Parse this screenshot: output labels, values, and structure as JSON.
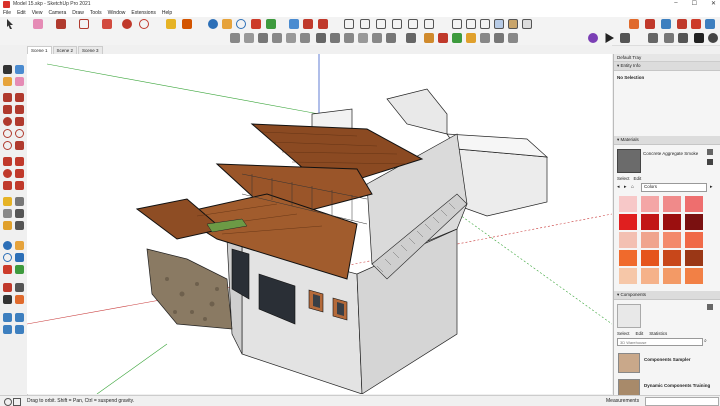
{
  "window": {
    "title": "Model 15.skp - SketchUp Pro 2021"
  },
  "menu": [
    "File",
    "Edit",
    "View",
    "Camera",
    "Draw",
    "Tools",
    "Window",
    "Extensions",
    "Help"
  ],
  "scenes": [
    "Scene 1",
    "Scene 2",
    "Scene 3"
  ],
  "tray": {
    "title": "Default Tray",
    "entity_info": {
      "header": "Entity Info",
      "selection": "No Selection"
    },
    "materials": {
      "header": "Materials",
      "current": "Concrete Aggregate Smoke",
      "tabs": [
        "Select",
        "Edit"
      ],
      "collection": "Colors",
      "swatches": [
        "#f7c8c8",
        "#f4a6a6",
        "#f08a8a",
        "#ee6e6e",
        "#e01f1f",
        "#c21616",
        "#9b0f0f",
        "#7a1010",
        "#f3c0b2",
        "#f0a58e",
        "#f38a6b",
        "#f06a48",
        "#f06a2c",
        "#e5541c",
        "#c8471a",
        "#9a3716",
        "#f6c7a8",
        "#f5b28a",
        "#f39a66",
        "#f28045"
      ]
    },
    "components": {
      "header": "Components",
      "tabs": [
        "Select",
        "Edit",
        "Statistics"
      ],
      "search_placeholder": "3D Warehouse",
      "items": [
        {
          "name": "Components Sampler"
        },
        {
          "name": "Dynamic Components Training"
        }
      ]
    }
  },
  "status": {
    "message": "Drag to orbit. Shift = Pan, Ctrl = suspend gravity.",
    "measurements_label": "Measurements"
  }
}
